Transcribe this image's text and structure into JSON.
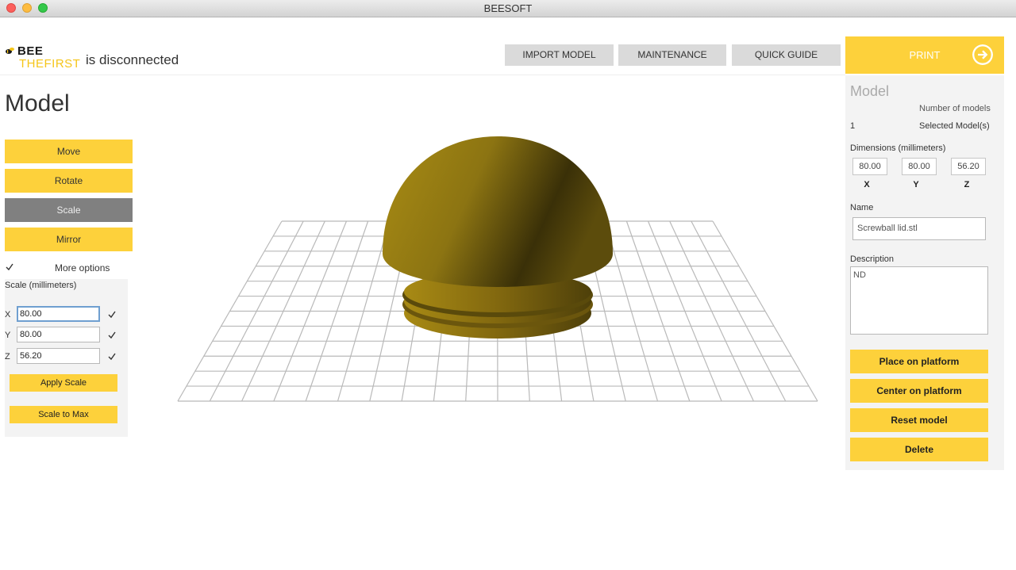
{
  "window": {
    "title": "BEESOFT"
  },
  "header": {
    "logo_top": "BEE",
    "logo_bottom": "THEFIRST",
    "status": "is disconnected",
    "buttons": {
      "import": "IMPORT MODEL",
      "maintenance": "MAINTENANCE",
      "guide": "QUICK GUIDE"
    },
    "print": "PRINT"
  },
  "left": {
    "title": "Model",
    "tools": {
      "move": "Move",
      "rotate": "Rotate",
      "scale": "Scale",
      "mirror": "Mirror"
    },
    "active_tool": "Scale",
    "more_options": "More options",
    "scale": {
      "title": "Scale (millimeters)",
      "x_label": "X",
      "y_label": "Y",
      "z_label": "Z",
      "x": "80.00",
      "y": "80.00",
      "z": "56.20",
      "apply": "Apply Scale",
      "max": "Scale to Max"
    }
  },
  "viewport": {
    "model_color": "#8a7410",
    "grid_color": "#b9b9b9"
  },
  "right": {
    "title": "Model",
    "num_models_label": "Number of models",
    "num_models": "1",
    "selected_label": "Selected Model(s)",
    "dimensions_label": "Dimensions (millimeters)",
    "dims": {
      "x": "80.00",
      "y": "80.00",
      "z": "56.20"
    },
    "dim_labels": {
      "x": "X",
      "y": "Y",
      "z": "Z"
    },
    "name_label": "Name",
    "name": "Screwball lid.stl",
    "desc_label": "Description",
    "desc": "ND",
    "actions": {
      "place": "Place on platform",
      "center": "Center on platform",
      "reset": "Reset model",
      "delete": "Delete"
    }
  },
  "colors": {
    "accent": "#fdd13b",
    "active": "#808080"
  }
}
